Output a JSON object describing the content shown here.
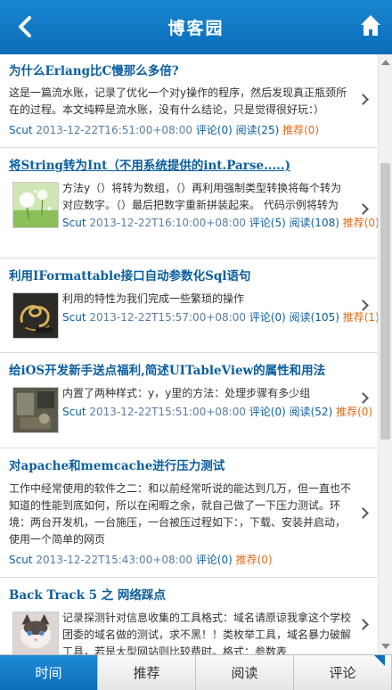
{
  "header": {
    "title": "博客园",
    "back_icon": "back-arrow-icon",
    "home_icon": "home-icon",
    "color": "#0b76c4"
  },
  "posts": [
    {
      "title": "为什么Erlang比C慢那么多倍?",
      "summary": "这是一篇流水账，记录了优化一个对y操作的程序，然后发现真正瓶颈所在的过程。本文纯粹是流水账，没有什么结论，只是觉得很好玩：）",
      "author": "Scut",
      "date": "2013-12-22T16:51:00+08:00",
      "comments": "评论(0)",
      "reads": "阅读(25)",
      "recommend": "推荐(0)"
    },
    {
      "title": "将String转为Int（不用系统提供的int.Parse.....)",
      "summary": "方法y（）将转为数组，（）再利用强制类型转换将每个转为对应数字。（）最后把数字重新拼装起来。  代码示例将转为",
      "author": "Scut",
      "date": "2013-12-22T16:10:00+08:00",
      "comments": "评论(5)",
      "reads": "阅读(108)",
      "recommend": "推荐(0)"
    },
    {
      "title": "利用IFormattable接口自动参数化Sql语句",
      "summary": "利用的特性为我们完成一些繁琐的操作",
      "author": "Scut",
      "date": "2013-12-22T15:57:00+08:00",
      "comments": "评论(0)",
      "reads": "阅读(105)",
      "recommend": "推荐(1)"
    },
    {
      "title": "给iOS开发新手送点福利,简述UITableView的属性和用法",
      "summary": "内置了两种样式：y，y里的方法：处理步骤有多少组",
      "author": "Scut",
      "date": "2013-12-22T15:51:00+08:00",
      "comments": "评论(0)",
      "reads": "阅读(52)",
      "recommend": "推荐(0)"
    },
    {
      "title": "对apache和memcache进行压力测试",
      "summary": "工作中经常使用的软件之二：和以前经常听说的能达到几万，但一直也不知道的性能到底如何，所以在闲暇之余，就自己做了一下压力测试。环境：两台开发机，一台施压，一台被压过程如下：，下载、安装并启动，使用一个简单的网页",
      "author": "Scut",
      "date": "2013-12-22T15:43:00+08:00",
      "comments": "评论(0)",
      "reads": "阅读(107)",
      "recommend": "推荐(0)"
    },
    {
      "title": "Back Track 5 之 网络踩点",
      "summary": "记录探测针对信息收集的工具格式：域名请原谅我拿这个学校团委的域名做的测试，求不黑！！类枚举工具，域名暴力破解工具，若是大型网站则比较费时。格式：参数表"
    }
  ],
  "tabs": [
    {
      "label": "时间",
      "active": true
    },
    {
      "label": "推荐",
      "active": false
    },
    {
      "label": "阅读",
      "active": false
    },
    {
      "label": "评论",
      "active": false
    }
  ],
  "colors": {
    "link": "#0b5e9e",
    "recommend": "#e36a16",
    "tab_active": "#1a7fcb"
  }
}
